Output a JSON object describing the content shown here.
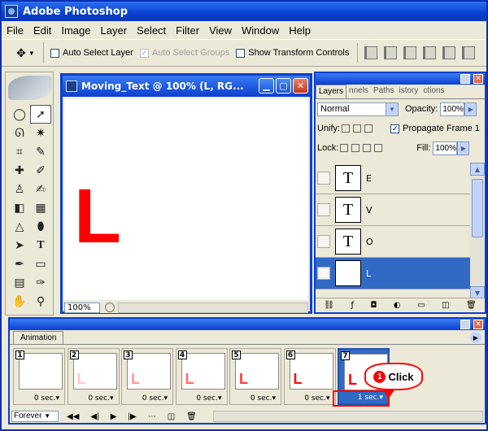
{
  "app": {
    "title": "Adobe Photoshop"
  },
  "menu": [
    "File",
    "Edit",
    "Image",
    "Layer",
    "Select",
    "Filter",
    "View",
    "Window",
    "Help"
  ],
  "options": {
    "auto_select_layer": "Auto Select Layer",
    "auto_select_groups": "Auto Select Groups",
    "show_transform_controls": "Show Transform Controls"
  },
  "document": {
    "title": "Moving_Text @ 100% (L, RG...",
    "zoom": "100%",
    "canvas_letter": "L"
  },
  "layers_panel": {
    "tabs": [
      "Layers",
      "nnels",
      "Paths",
      "istory",
      "ctions"
    ],
    "blend_mode": "Normal",
    "opacity_label": "Opacity:",
    "opacity_value": "100%",
    "unify_label": "Unify:",
    "propagate_label": "Propagate Frame 1",
    "lock_label": "Lock:",
    "fill_label": "Fill:",
    "fill_value": "100%",
    "layers": [
      {
        "thumb": "T",
        "name": "E",
        "visible": false,
        "selected": false
      },
      {
        "thumb": "T",
        "name": "V",
        "visible": false,
        "selected": false
      },
      {
        "thumb": "T",
        "name": "O",
        "visible": false,
        "selected": false
      },
      {
        "thumb": "T",
        "name": "L",
        "visible": true,
        "selected": true
      }
    ]
  },
  "animation_panel": {
    "tab": "Animation",
    "loop": "Forever",
    "frames": [
      {
        "num": "1",
        "delay": "0 sec.",
        "letter": "",
        "color": "#ffffff"
      },
      {
        "num": "2",
        "delay": "0 sec.",
        "letter": "L",
        "color": "#ffc8c8"
      },
      {
        "num": "3",
        "delay": "0 sec.",
        "letter": "L",
        "color": "#ff9a9a"
      },
      {
        "num": "4",
        "delay": "0 sec.",
        "letter": "L",
        "color": "#ff6a6a"
      },
      {
        "num": "5",
        "delay": "0 sec.",
        "letter": "L",
        "color": "#ff3a3a"
      },
      {
        "num": "6",
        "delay": "0 sec.",
        "letter": "L",
        "color": "#ff1010"
      },
      {
        "num": "7",
        "delay": "1 sec.",
        "letter": "L",
        "color": "#ff0000"
      }
    ],
    "selected_frame": 7
  },
  "callout": {
    "step": "1",
    "text": "Click"
  },
  "colors": {
    "accent": "#0a3fd0",
    "selection": "#316ac5",
    "highlight": "#ff0000"
  }
}
